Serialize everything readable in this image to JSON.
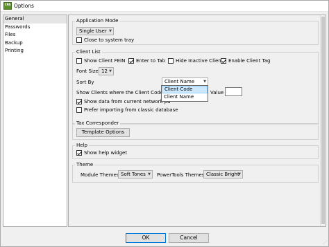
{
  "window": {
    "title": "Options",
    "icon_text": "CPA"
  },
  "sidebar": {
    "items": [
      {
        "label": "General",
        "selected": true
      },
      {
        "label": "Passwords"
      },
      {
        "label": "Files"
      },
      {
        "label": "Backup"
      },
      {
        "label": "Printing"
      }
    ]
  },
  "application_mode": {
    "title": "Application Mode",
    "mode_value": "Single User",
    "close_to_tray_label": "Close to system tray",
    "close_to_tray_checked": false
  },
  "client_list": {
    "title": "Client List",
    "show_fein_label": "Show Client FEIN",
    "show_fein_checked": false,
    "enter_to_tab_label": "Enter to Tab",
    "enter_to_tab_checked": true,
    "hide_inactive_label": "Hide Inactive Clients",
    "hide_inactive_checked": false,
    "enable_tag_label": "Enable Client Tag",
    "enable_tag_checked": true,
    "font_size_label": "Font Size",
    "font_size_value": "12",
    "sort_by_label": "Sort By",
    "sort_by_value": "Client Name",
    "sort_by_options": [
      "Client Code",
      "Client Name"
    ],
    "show_where_label": "Show Clients where the Client Code is",
    "value_label": "Value",
    "value_input": "",
    "show_network_label": "Show data from current network pa",
    "show_network_checked": true,
    "prefer_classic_label": "Prefer importing from classic database",
    "prefer_classic_checked": false
  },
  "tax_corresponder": {
    "title": "Tax Corresponder",
    "template_button": "Template Options"
  },
  "help": {
    "title": "Help",
    "show_widget_label": "Show help widget",
    "show_widget_checked": true
  },
  "theme": {
    "title": "Theme",
    "module_label": "Module Themes",
    "module_value": "Soft Tones",
    "powertools_label": "PowerTools Themes",
    "powertools_value": "Classic Bright"
  },
  "footer": {
    "ok_label": "OK",
    "cancel_label": "Cancel"
  }
}
